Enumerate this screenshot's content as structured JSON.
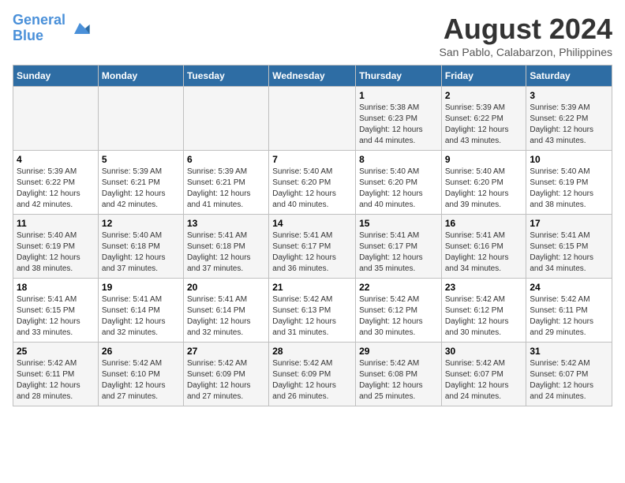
{
  "header": {
    "logo_line1": "General",
    "logo_line2": "Blue",
    "main_title": "August 2024",
    "subtitle": "San Pablo, Calabarzon, Philippines"
  },
  "days_of_week": [
    "Sunday",
    "Monday",
    "Tuesday",
    "Wednesday",
    "Thursday",
    "Friday",
    "Saturday"
  ],
  "weeks": [
    [
      {
        "day": "",
        "info": ""
      },
      {
        "day": "",
        "info": ""
      },
      {
        "day": "",
        "info": ""
      },
      {
        "day": "",
        "info": ""
      },
      {
        "day": "1",
        "info": "Sunrise: 5:38 AM\nSunset: 6:23 PM\nDaylight: 12 hours\nand 44 minutes."
      },
      {
        "day": "2",
        "info": "Sunrise: 5:39 AM\nSunset: 6:22 PM\nDaylight: 12 hours\nand 43 minutes."
      },
      {
        "day": "3",
        "info": "Sunrise: 5:39 AM\nSunset: 6:22 PM\nDaylight: 12 hours\nand 43 minutes."
      }
    ],
    [
      {
        "day": "4",
        "info": "Sunrise: 5:39 AM\nSunset: 6:22 PM\nDaylight: 12 hours\nand 42 minutes."
      },
      {
        "day": "5",
        "info": "Sunrise: 5:39 AM\nSunset: 6:21 PM\nDaylight: 12 hours\nand 42 minutes."
      },
      {
        "day": "6",
        "info": "Sunrise: 5:39 AM\nSunset: 6:21 PM\nDaylight: 12 hours\nand 41 minutes."
      },
      {
        "day": "7",
        "info": "Sunrise: 5:40 AM\nSunset: 6:20 PM\nDaylight: 12 hours\nand 40 minutes."
      },
      {
        "day": "8",
        "info": "Sunrise: 5:40 AM\nSunset: 6:20 PM\nDaylight: 12 hours\nand 40 minutes."
      },
      {
        "day": "9",
        "info": "Sunrise: 5:40 AM\nSunset: 6:20 PM\nDaylight: 12 hours\nand 39 minutes."
      },
      {
        "day": "10",
        "info": "Sunrise: 5:40 AM\nSunset: 6:19 PM\nDaylight: 12 hours\nand 38 minutes."
      }
    ],
    [
      {
        "day": "11",
        "info": "Sunrise: 5:40 AM\nSunset: 6:19 PM\nDaylight: 12 hours\nand 38 minutes."
      },
      {
        "day": "12",
        "info": "Sunrise: 5:40 AM\nSunset: 6:18 PM\nDaylight: 12 hours\nand 37 minutes."
      },
      {
        "day": "13",
        "info": "Sunrise: 5:41 AM\nSunset: 6:18 PM\nDaylight: 12 hours\nand 37 minutes."
      },
      {
        "day": "14",
        "info": "Sunrise: 5:41 AM\nSunset: 6:17 PM\nDaylight: 12 hours\nand 36 minutes."
      },
      {
        "day": "15",
        "info": "Sunrise: 5:41 AM\nSunset: 6:17 PM\nDaylight: 12 hours\nand 35 minutes."
      },
      {
        "day": "16",
        "info": "Sunrise: 5:41 AM\nSunset: 6:16 PM\nDaylight: 12 hours\nand 34 minutes."
      },
      {
        "day": "17",
        "info": "Sunrise: 5:41 AM\nSunset: 6:15 PM\nDaylight: 12 hours\nand 34 minutes."
      }
    ],
    [
      {
        "day": "18",
        "info": "Sunrise: 5:41 AM\nSunset: 6:15 PM\nDaylight: 12 hours\nand 33 minutes."
      },
      {
        "day": "19",
        "info": "Sunrise: 5:41 AM\nSunset: 6:14 PM\nDaylight: 12 hours\nand 32 minutes."
      },
      {
        "day": "20",
        "info": "Sunrise: 5:41 AM\nSunset: 6:14 PM\nDaylight: 12 hours\nand 32 minutes."
      },
      {
        "day": "21",
        "info": "Sunrise: 5:42 AM\nSunset: 6:13 PM\nDaylight: 12 hours\nand 31 minutes."
      },
      {
        "day": "22",
        "info": "Sunrise: 5:42 AM\nSunset: 6:12 PM\nDaylight: 12 hours\nand 30 minutes."
      },
      {
        "day": "23",
        "info": "Sunrise: 5:42 AM\nSunset: 6:12 PM\nDaylight: 12 hours\nand 30 minutes."
      },
      {
        "day": "24",
        "info": "Sunrise: 5:42 AM\nSunset: 6:11 PM\nDaylight: 12 hours\nand 29 minutes."
      }
    ],
    [
      {
        "day": "25",
        "info": "Sunrise: 5:42 AM\nSunset: 6:11 PM\nDaylight: 12 hours\nand 28 minutes."
      },
      {
        "day": "26",
        "info": "Sunrise: 5:42 AM\nSunset: 6:10 PM\nDaylight: 12 hours\nand 27 minutes."
      },
      {
        "day": "27",
        "info": "Sunrise: 5:42 AM\nSunset: 6:09 PM\nDaylight: 12 hours\nand 27 minutes."
      },
      {
        "day": "28",
        "info": "Sunrise: 5:42 AM\nSunset: 6:09 PM\nDaylight: 12 hours\nand 26 minutes."
      },
      {
        "day": "29",
        "info": "Sunrise: 5:42 AM\nSunset: 6:08 PM\nDaylight: 12 hours\nand 25 minutes."
      },
      {
        "day": "30",
        "info": "Sunrise: 5:42 AM\nSunset: 6:07 PM\nDaylight: 12 hours\nand 24 minutes."
      },
      {
        "day": "31",
        "info": "Sunrise: 5:42 AM\nSunset: 6:07 PM\nDaylight: 12 hours\nand 24 minutes."
      }
    ]
  ]
}
